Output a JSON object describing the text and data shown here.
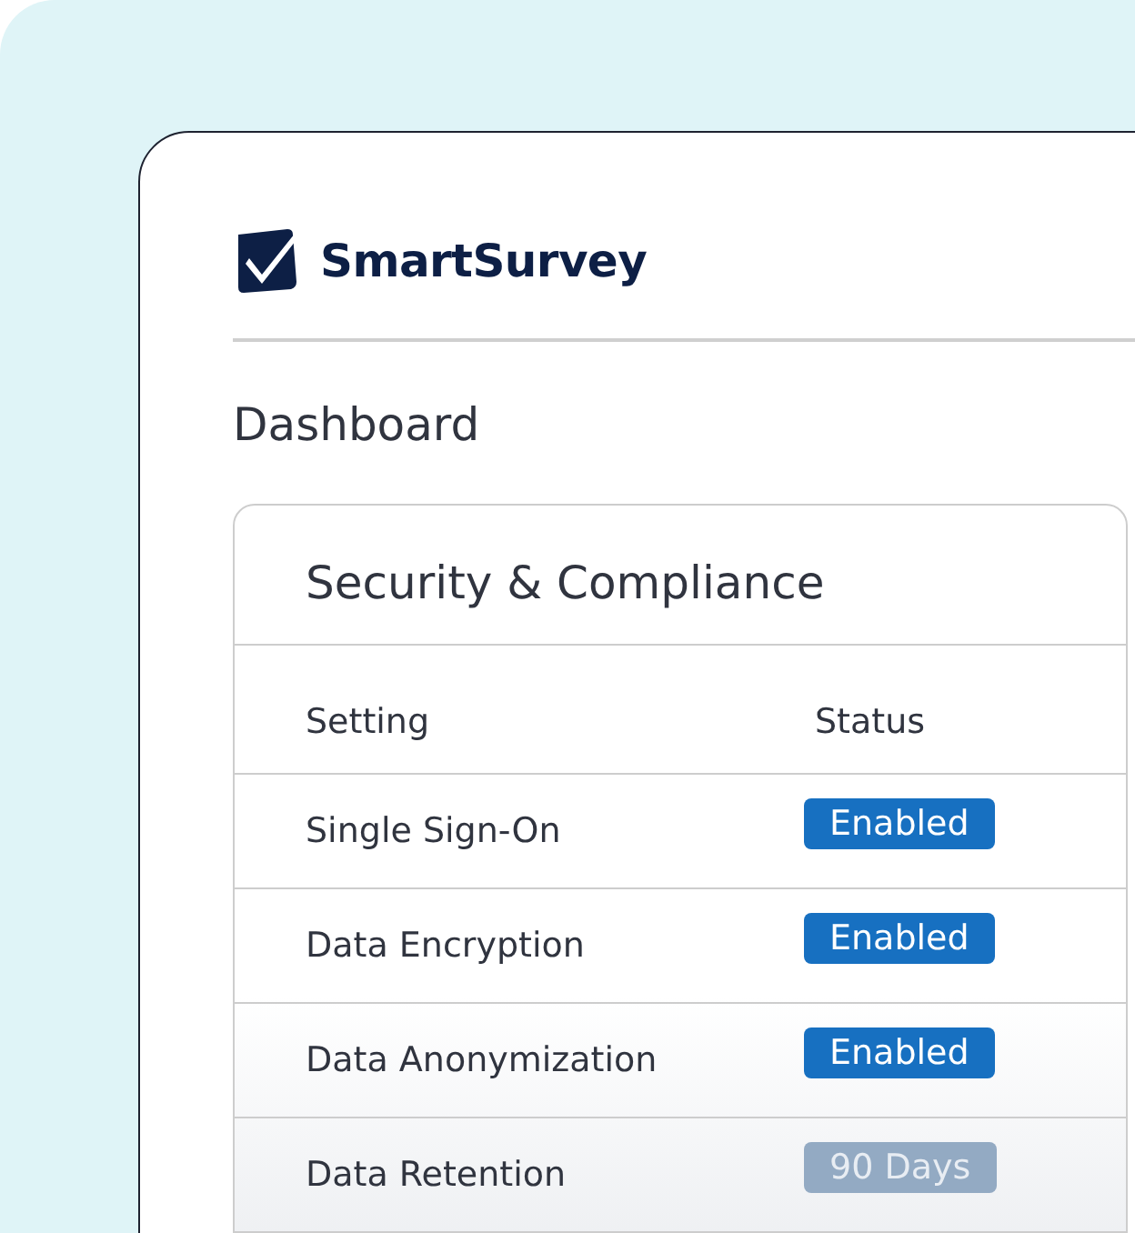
{
  "brand": {
    "name": "SmartSurvey"
  },
  "page_title": "Dashboard",
  "panel": {
    "title": "Security & Compliance",
    "columns": [
      "Setting",
      "Status"
    ],
    "rows": [
      {
        "setting": "Single Sign-On",
        "status": "Enabled",
        "kind": "enabled"
      },
      {
        "setting": "Data Encryption",
        "status": "Enabled",
        "kind": "enabled"
      },
      {
        "setting": "Data Anonymization",
        "status": "Enabled",
        "kind": "enabled"
      },
      {
        "setting": "Data Retention",
        "status": "90 Days",
        "kind": "muted"
      }
    ]
  }
}
